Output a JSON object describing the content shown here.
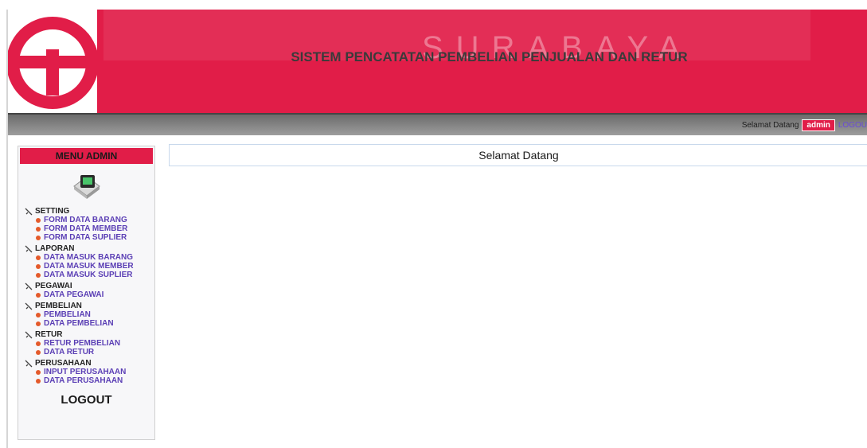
{
  "header": {
    "watermark": "SURABAYA",
    "title": "SISTEM PENCATATAN PEMBELIAN PENJUALAN DAN RETUR"
  },
  "topbar": {
    "welcome_text": "Selamat Datang",
    "user": "admin",
    "logout_label": "LOGOU"
  },
  "sidebar": {
    "menu_title": "MENU ADMIN",
    "groups": [
      {
        "title": "SETTING",
        "items": [
          "FORM DATA BARANG",
          "FORM DATA MEMBER",
          "FORM DATA SUPLIER"
        ]
      },
      {
        "title": "LAPORAN",
        "items": [
          "DATA MASUK BARANG",
          "DATA MASUK MEMBER",
          "DATA MASUK SUPLIER"
        ]
      },
      {
        "title": "PEGAWAI",
        "items": [
          "DATA PEGAWAI"
        ]
      },
      {
        "title": "PEMBELIAN",
        "items": [
          "PEMBELIAN",
          "DATA PEMBELIAN"
        ]
      },
      {
        "title": "RETUR",
        "items": [
          "RETUR PEMBELIAN",
          "DATA RETUR"
        ]
      },
      {
        "title": "PERUSAHAAN",
        "items": [
          "INPUT PERUSAHAAN",
          "DATA PERUSAHAAN"
        ]
      }
    ],
    "logout_label": "LOGOUT"
  },
  "main": {
    "heading": "Selamat Datang"
  },
  "colors": {
    "brand": "#e11d48",
    "link": "#5b3fb5",
    "bar": "#8a8a8a"
  },
  "icons": {
    "logo": "brand-logo-icon",
    "menu": "computer-icon",
    "group": "tool-icon",
    "item": "bullet-icon"
  }
}
